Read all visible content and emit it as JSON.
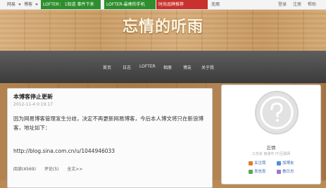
{
  "topbar": {
    "home": "网易",
    "blog": "博客",
    "lofter_promo_1": "LOFTER： 1知道 事件下来",
    "lofter_promo_2": "LOFTER-最棒的手机",
    "promo_red": "时尚品牌推荐",
    "dark_label": "无瑕",
    "right_items": [
      "登录",
      "注册",
      "帮助"
    ]
  },
  "header": {
    "site_title": "忘情的听雨"
  },
  "nav": {
    "items": [
      "首页",
      "日志",
      "LOFTER",
      "相册",
      "博友",
      "关于我"
    ]
  },
  "post": {
    "title": "本博客停止更新",
    "date": "2012-11-4 0:19:17",
    "body": "因为网易博客管理发生分歧，决定不再更新网易博客，今后本人博文将只在新浪博客，地址如下：",
    "url": "http://blog.sina.com.cn/u/1044946033",
    "meta": {
      "reads": "阅读(4569)",
      "comments": "评论(5)",
      "full": "全文>>"
    }
  },
  "sidebar": {
    "name": "忘情",
    "sub": "江苏省  南通市  IT/互联网",
    "buttons": [
      "关注我",
      "加博友",
      "发信息",
      "看日志"
    ]
  },
  "colors": {
    "green": "#2e8e2e",
    "red": "#c8312d",
    "link": "#3a6bb5"
  }
}
